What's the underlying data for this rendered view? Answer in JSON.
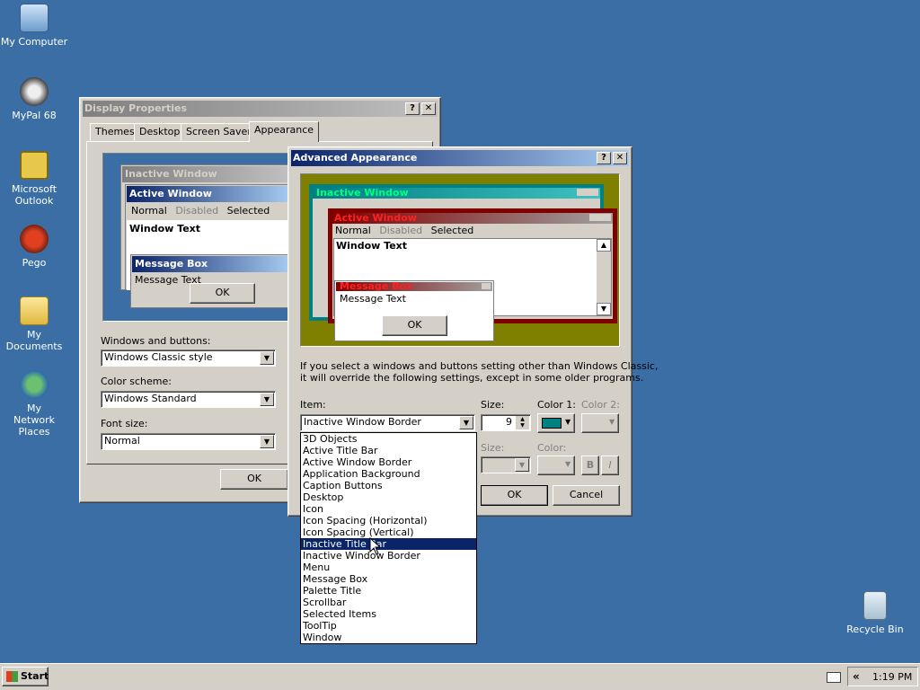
{
  "desktop": {
    "icons": [
      {
        "label": "My Computer",
        "icon": "computer-icon"
      },
      {
        "label": "MyPal 68",
        "icon": "raccoon-icon"
      },
      {
        "label": "Microsoft Outlook",
        "icon": "outlook-icon"
      },
      {
        "label": "Pego",
        "icon": "pego-icon"
      },
      {
        "label": "My Documents",
        "icon": "folder-icon"
      },
      {
        "label": "My Network Places",
        "icon": "network-icon"
      },
      {
        "label": "Recycle Bin",
        "icon": "recycle-bin-icon"
      }
    ],
    "background_color": "#3a6ea5"
  },
  "display_properties": {
    "title": "Display Properties",
    "help": "?",
    "close": "✕",
    "tabs": [
      "Themes",
      "Desktop",
      "Screen Saver",
      "Appearance"
    ],
    "preview": {
      "inactive_title": "Inactive Window",
      "active_title": "Active Window",
      "menu": [
        "Normal",
        "Disabled",
        "Selected"
      ],
      "window_text": "Window Text",
      "message_box_title": "Message Box",
      "message_text": "Message Text",
      "ok": "OK"
    },
    "windows_buttons_label": "Windows and buttons:",
    "windows_buttons_value": "Windows Classic style",
    "color_scheme_label": "Color scheme:",
    "color_scheme_value": "Windows Standard",
    "font_size_label": "Font size:",
    "font_size_value": "Normal",
    "ok": "OK"
  },
  "advanced": {
    "title": "Advanced Appearance",
    "help": "?",
    "close": "✕",
    "preview": {
      "inactive_title": "Inactive Window",
      "active_title": "Active Window",
      "menu": [
        "Normal",
        "Disabled",
        "Selected"
      ],
      "window_text": "Window Text",
      "message_box_title": "Message Box",
      "message_text": "Message Text",
      "ok": "OK"
    },
    "info_text_1": "If you select a windows and buttons setting other than Windows Classic,",
    "info_text_2": "it will override the following settings, except in some older programs.",
    "item_label": "Item:",
    "item_value": "Inactive Window Border",
    "size_label": "Size:",
    "size_value": "9",
    "color1_label": "Color 1:",
    "color1_value": "#008080",
    "color2_label": "Color 2:",
    "font_size_label": "Size:",
    "font_color_label": "Color:",
    "bold": "B",
    "italic": "I",
    "ok": "OK",
    "cancel": "Cancel",
    "dropdown_items": [
      "3D Objects",
      "Active Title Bar",
      "Active Window Border",
      "Application Background",
      "Caption Buttons",
      "Desktop",
      "Icon",
      "Icon Spacing (Horizontal)",
      "Icon Spacing (Vertical)",
      "Inactive Title Bar",
      "Inactive Window Border",
      "Menu",
      "Message Box",
      "Palette Title",
      "Scrollbar",
      "Selected Items",
      "ToolTip",
      "Window"
    ],
    "dropdown_selected": "Inactive Title Bar"
  },
  "taskbar": {
    "start": "Start",
    "tray_chevron": "«",
    "clock": "1:19 PM"
  }
}
